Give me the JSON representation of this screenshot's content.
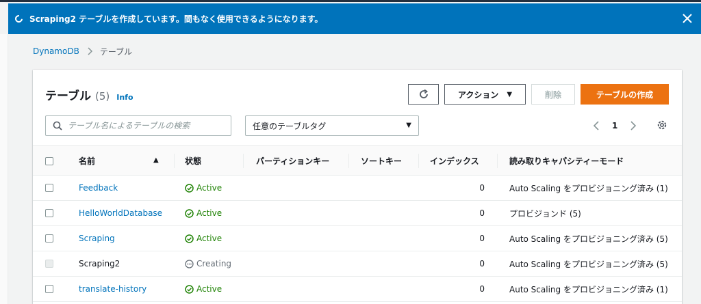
{
  "flash": {
    "message": "Scraping2 テーブルを作成しています。間もなく使用できるようになります。"
  },
  "breadcrumb": {
    "root": "DynamoDB",
    "current": "テーブル"
  },
  "panel": {
    "title": "テーブル",
    "count": "(5)",
    "info": "Info"
  },
  "toolbar": {
    "actions_label": "アクション",
    "delete_label": "削除",
    "create_label": "テーブルの作成"
  },
  "search": {
    "placeholder": "テーブル名によるテーブルの検索"
  },
  "tag_filter": {
    "selected": "任意のテーブルタグ"
  },
  "pagination": {
    "current_page": "1"
  },
  "table": {
    "columns": {
      "name": "名前",
      "status": "状態",
      "partition_key": "パーティションキー",
      "sort_key": "ソートキー",
      "indexes": "インデックス",
      "capacity_mode": "読み取りキャパシティーモード"
    },
    "rows": [
      {
        "name": "Feedback",
        "status": "Active",
        "indexes": "0",
        "capacity": "Auto Scaling をプロビジョニング済み (1)"
      },
      {
        "name": "HelloWorldDatabase",
        "status": "Active",
        "indexes": "0",
        "capacity": "プロビジョンド (5)"
      },
      {
        "name": "Scraping",
        "status": "Active",
        "indexes": "0",
        "capacity": "Auto Scaling をプロビジョニング済み (5)"
      },
      {
        "name": "Scraping2",
        "status": "Creating",
        "indexes": "0",
        "capacity": "Auto Scaling をプロビジョニング済み (5)"
      },
      {
        "name": "translate-history",
        "status": "Active",
        "indexes": "0",
        "capacity": "Auto Scaling をプロビジョニング済み (1)"
      }
    ]
  },
  "colors": {
    "flash_bg": "#0073bb",
    "link": "#0073bb",
    "primary_button": "#ec7211",
    "active_status": "#1d8102",
    "creating_status": "#687078"
  }
}
